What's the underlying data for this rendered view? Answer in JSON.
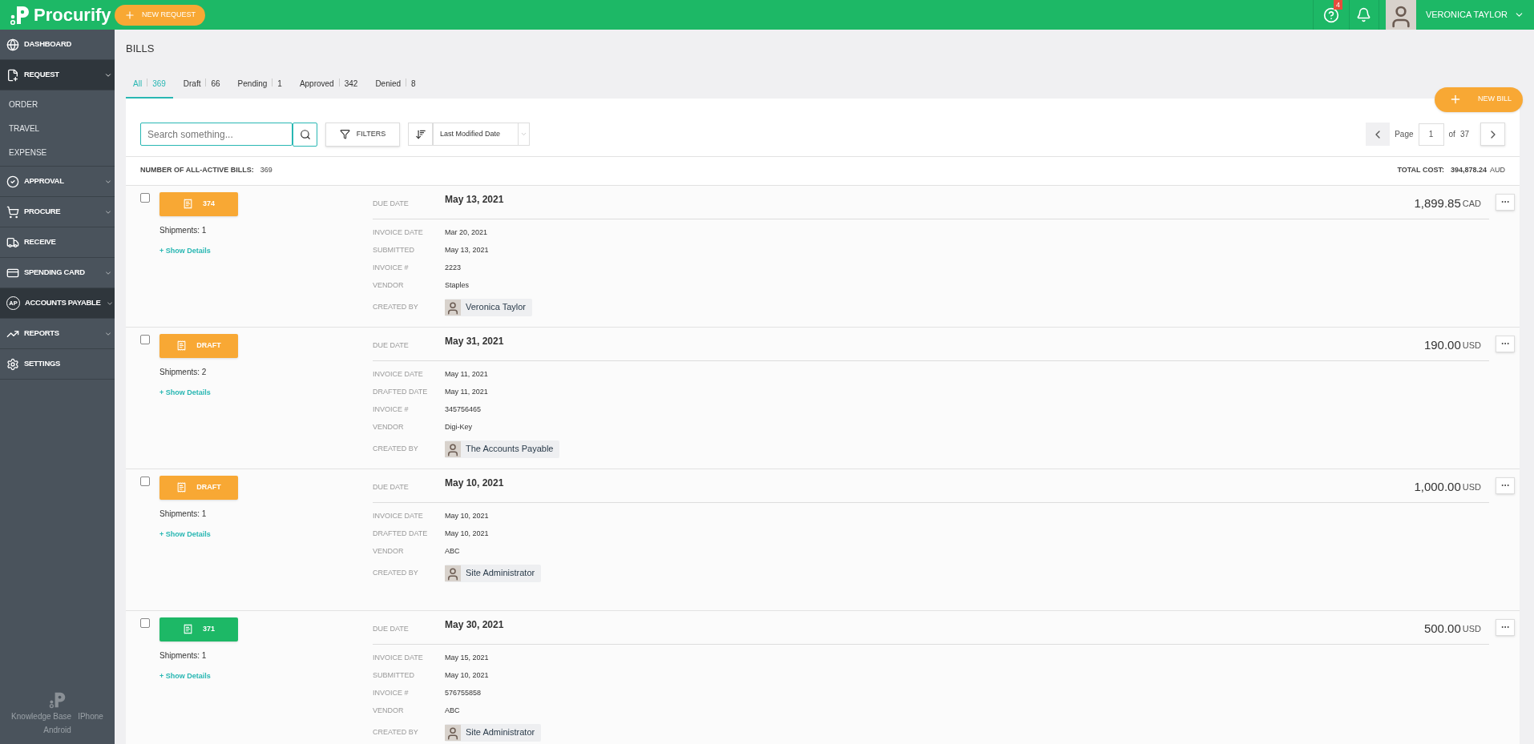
{
  "topbar": {
    "logo": "Procurify",
    "new_request": "NEW REQUEST",
    "help_badge": "4",
    "user_name": "VERONICA TAYLOR"
  },
  "sidebar": {
    "items": [
      {
        "label": "DASHBOARD",
        "selected": false
      },
      {
        "label": "REQUEST",
        "selected": true,
        "expanded": true,
        "children": [
          {
            "label": "ORDER"
          },
          {
            "label": "TRAVEL"
          },
          {
            "label": "EXPENSE"
          }
        ]
      },
      {
        "label": "APPROVAL",
        "selected": false,
        "expanded": false
      },
      {
        "label": "PROCURE",
        "selected": false,
        "expanded": false
      },
      {
        "label": "RECEIVE",
        "selected": false
      },
      {
        "label": "SPENDING CARD",
        "selected": false,
        "expanded": false
      },
      {
        "label": "ACCOUNTS PAYABLE",
        "selected": true,
        "expanded": false,
        "icon_text": "AP"
      },
      {
        "label": "REPORTS",
        "selected": false,
        "expanded": false
      },
      {
        "label": "SETTINGS",
        "selected": false
      }
    ],
    "footer_links": [
      "Knowledge Base",
      "IPhone",
      "Android"
    ]
  },
  "page": {
    "title": "BILLS",
    "tabs": [
      {
        "label": "All",
        "count": "369",
        "selected": true
      },
      {
        "label": "Draft",
        "count": "66",
        "selected": false
      },
      {
        "label": "Pending",
        "count": "1",
        "selected": false
      },
      {
        "label": "Approved",
        "count": "342",
        "selected": false
      },
      {
        "label": "Denied",
        "count": "8",
        "selected": false
      }
    ],
    "new_bill": "NEW BILL",
    "search": {
      "placeholder": "Search something..."
    },
    "filters": "FILTERS",
    "sort": {
      "value": "Last Modified Date"
    },
    "pagination": {
      "label": "Page",
      "value": "1",
      "of": "of",
      "total": "37"
    },
    "summary": {
      "count_label": "NUMBER OF ALL-ACTIVE BILLS:",
      "count": "369",
      "total_label": "TOTAL COST:",
      "total": "394,878.24",
      "currency": "AUD"
    }
  },
  "bills": [
    {
      "badge": "374",
      "color": "#f8a834",
      "checked": false,
      "shipments": "Shipments: 1",
      "show_details": "+ Show Details",
      "due_label": "DUE DATE",
      "due_date": "May 13, 2021",
      "amount": "1,899.85",
      "currency": "CAD",
      "fields": [
        {
          "label": "INVOICE DATE",
          "value": "Mar 20, 2021"
        },
        {
          "label": "SUBMITTED",
          "value": "May 13, 2021"
        },
        {
          "label": "INVOICE #",
          "value": "2223"
        },
        {
          "label": "VENDOR",
          "value": "Staples"
        }
      ],
      "created_by": {
        "label": "CREATED BY",
        "name": "Veronica Taylor"
      }
    },
    {
      "badge": "DRAFT",
      "color": "#f8a834",
      "checked": false,
      "shipments": "Shipments: 2",
      "show_details": "+ Show Details",
      "due_label": "DUE DATE",
      "due_date": "May 31, 2021",
      "amount": "190.00",
      "currency": "USD",
      "fields": [
        {
          "label": "INVOICE DATE",
          "value": "May 11, 2021"
        },
        {
          "label": "DRAFTED DATE",
          "value": "May 11, 2021"
        },
        {
          "label": "INVOICE #",
          "value": "345756465"
        },
        {
          "label": "VENDOR",
          "value": "Digi-Key"
        }
      ],
      "created_by": {
        "label": "CREATED BY",
        "name": "The Accounts Payable"
      }
    },
    {
      "badge": "DRAFT",
      "color": "#f8a834",
      "checked": false,
      "shipments": "Shipments: 1",
      "show_details": "+ Show Details",
      "due_label": "DUE DATE",
      "due_date": "May 10, 2021",
      "amount": "1,000.00",
      "currency": "USD",
      "fields": [
        {
          "label": "INVOICE DATE",
          "value": "May 10, 2021"
        },
        {
          "label": "DRAFTED DATE",
          "value": "May 10, 2021"
        },
        {
          "label": "VENDOR",
          "value": "ABC"
        }
      ],
      "created_by": {
        "label": "CREATED BY",
        "name": "Site Administrator"
      }
    },
    {
      "badge": "371",
      "color": "#1db866",
      "checked": false,
      "shipments": "Shipments: 1",
      "show_details": "+ Show Details",
      "due_label": "DUE DATE",
      "due_date": "May 30, 2021",
      "amount": "500.00",
      "currency": "USD",
      "fields": [
        {
          "label": "INVOICE DATE",
          "value": "May 15, 2021"
        },
        {
          "label": "SUBMITTED",
          "value": "May 10, 2021"
        },
        {
          "label": "INVOICE #",
          "value": "576755858"
        },
        {
          "label": "VENDOR",
          "value": "ABC"
        }
      ],
      "created_by": {
        "label": "CREATED BY",
        "name": "Site Administrator"
      }
    }
  ]
}
